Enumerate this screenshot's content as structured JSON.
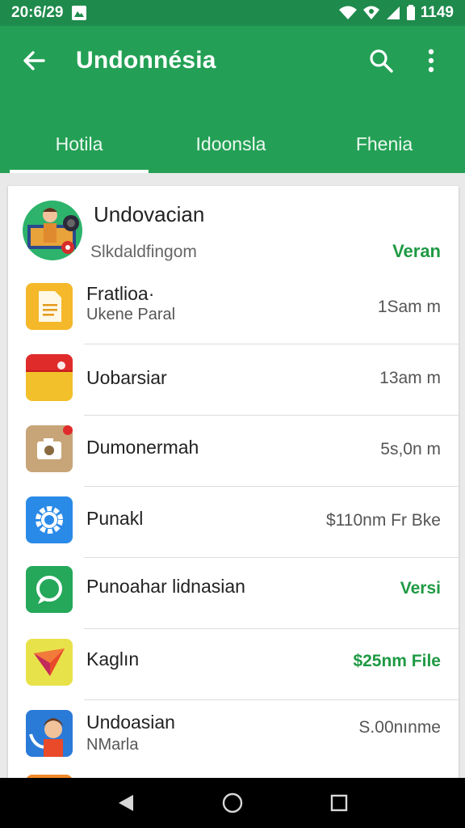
{
  "status": {
    "time": "20:6/29",
    "battery_text": "1149"
  },
  "toolbar": {
    "title": "Undonnésia"
  },
  "tabs": [
    {
      "label": "Hotila"
    },
    {
      "label": "Idoonsla"
    },
    {
      "label": "Fhenia"
    }
  ],
  "header": {
    "title": "Undovacian",
    "subtitle": "Slkdaldfingom",
    "action": "Veran"
  },
  "rows": [
    {
      "name": "Fratlioa·",
      "sub": "Ukene Paral",
      "meta": "1Sam m",
      "meta_green": false
    },
    {
      "name": "Uobarsiar",
      "sub": "",
      "meta": "13am m",
      "meta_green": false
    },
    {
      "name": "Dumonermah",
      "sub": "",
      "meta": "5s,0n m",
      "meta_green": false
    },
    {
      "name": "Punakl",
      "sub": "",
      "meta": "$110nm Fr Bke",
      "meta_green": false
    },
    {
      "name": "Punoahar lidnasian",
      "sub": "",
      "meta": "Versi",
      "meta_green": true
    },
    {
      "name": "Kaglın",
      "sub": "",
      "meta": "$25nm File",
      "meta_green": true
    },
    {
      "name": "Undoasian",
      "sub": "NMarla",
      "meta": "S.00nınme",
      "meta_green": false
    }
  ],
  "colors": {
    "status_bar": "#1e8a4c",
    "app_bar": "#23a055",
    "accent_green": "#1f9a44"
  }
}
